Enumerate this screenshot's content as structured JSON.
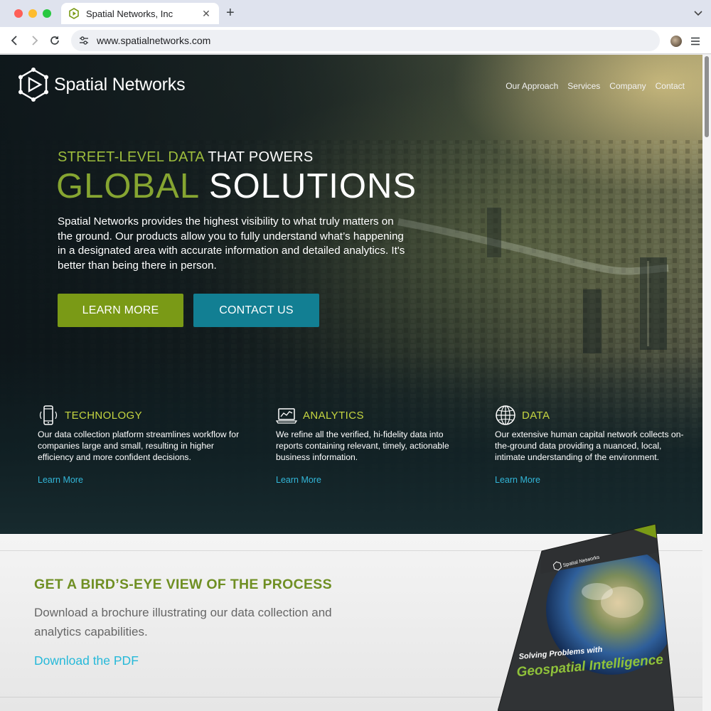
{
  "browser": {
    "tab_title": "Spatial Networks, Inc",
    "tab_close": "✕",
    "new_tab": "+",
    "url": "www.spatialnetworks.com"
  },
  "site": {
    "logo_text": "Spatial Networks",
    "nav": [
      "Our Approach",
      "Services",
      "Company",
      "Contact"
    ]
  },
  "hero": {
    "tagline_green": "STREET-LEVEL DATA",
    "tagline_rest": " THAT POWERS",
    "headline_green": "GLOBAL",
    "headline_rest": " SOLUTIONS",
    "body": "Spatial Networks provides the highest visibility to what truly matters on the ground. Our products allow you to fully understand what’s happening in a designated area with accurate information and detailed analytics. It's better than being there in person.",
    "btn_learn": "LEARN MORE",
    "btn_contact": "CONTACT US"
  },
  "features": [
    {
      "icon": "mobile-phone-icon",
      "title": "TECHNOLOGY",
      "text": "Our data collection platform streamlines workflow for companies large and small, resulting in higher efficiency and more confident decisions.",
      "link": "Learn More"
    },
    {
      "icon": "laptop-chart-icon",
      "title": "ANALYTICS",
      "text": "We refine all the verified, hi-fidelity data into reports containing relevant, timely, actionable business information.",
      "link": "Learn More"
    },
    {
      "icon": "globe-icon",
      "title": "DATA",
      "text": "Our extensive human capital network collects on-the-ground data providing a nuanced, local, intimate understanding of the  environment.",
      "link": "Learn More"
    }
  ],
  "process": {
    "title": "GET A BIRD’S-EYE VIEW OF THE PROCESS",
    "body": "Download a brochure illustrating our data collection and analytics capabilities.",
    "link": "Download the PDF"
  },
  "brochure": {
    "logo_text": "Spatial Networks",
    "line1": "Solving Problems with",
    "line2": "Geospatial Intelligence"
  },
  "colors": {
    "accent_green": "#7a9a16",
    "accent_teal": "#127f93",
    "link_blue": "#33b7d9",
    "title_green": "#6f8f23"
  }
}
